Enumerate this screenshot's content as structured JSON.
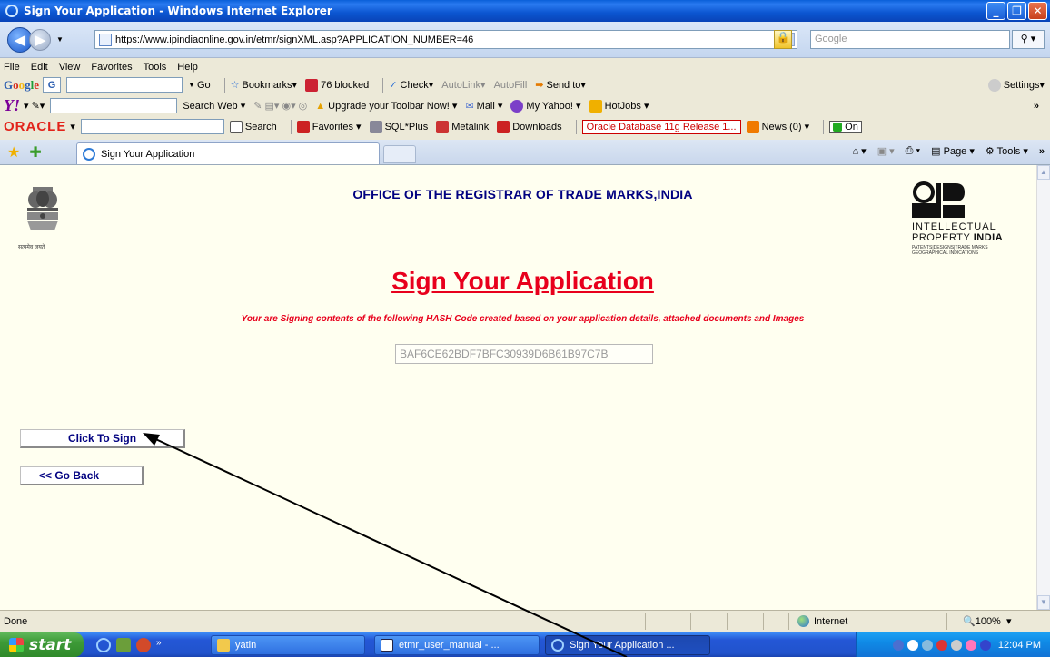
{
  "window": {
    "title": "Sign Your Application - Windows Internet Explorer"
  },
  "address_bar": {
    "url": "https://www.ipindiaonline.gov.in/etmr/signXML.asp?APPLICATION_NUMBER=46",
    "search_placeholder": "Google"
  },
  "menu": [
    "File",
    "Edit",
    "View",
    "Favorites",
    "Tools",
    "Help"
  ],
  "google_toolbar": {
    "brand": "Google",
    "items": [
      "Go",
      "Bookmarks",
      "76 blocked",
      "Check",
      "AutoLink",
      "AutoFill",
      "Send to"
    ],
    "settings": "Settings"
  },
  "yahoo_toolbar": {
    "brand": "Y!",
    "items": [
      "Search Web",
      "Upgrade your Toolbar Now!",
      "Mail",
      "My Yahoo!",
      "HotJobs"
    ],
    "more": "»"
  },
  "oracle_toolbar": {
    "brand": "ORACLE",
    "items": [
      "Search",
      "Favorites",
      "SQL*Plus",
      "Metalink",
      "Downloads"
    ],
    "news_link": "Oracle Database 11g Release 1...",
    "news": "News (0)",
    "on": "On"
  },
  "tab": {
    "label": "Sign Your Application"
  },
  "command_bar": {
    "page": "Page",
    "tools": "Tools"
  },
  "page": {
    "office_title": "OFFICE OF THE REGISTRAR OF TRADE MARKS,INDIA",
    "emblem_caption": "सत्यमेव जयते",
    "logo": {
      "line1": "INTELLECTUAL",
      "line2a": "PROPERTY",
      "line2b": "INDIA",
      "line3": "PATENTS|DESIGNS|TRADE MARKS GEOGRAPHICAL INDICATIONS"
    },
    "heading": "Sign Your Application",
    "subtext": "Your are Signing contents of the following HASH Code created based on your application details, attached documents and Images",
    "hash_value": "BAF6CE62BDF7BFC30939D6B61B97C7B",
    "sign_button": "Click To Sign",
    "back_button": "<< Go Back"
  },
  "status": {
    "text": "Done",
    "zone": "Internet",
    "zoom": "100%"
  },
  "taskbar": {
    "start": "start",
    "buttons": [
      "yatin",
      "etmr_user_manual - ...",
      "Sign Your Application ..."
    ],
    "clock": "12:04 PM"
  },
  "colors": {
    "heading_red": "#e8001c",
    "button_text": "#000080",
    "page_bg": "#fffff0"
  }
}
